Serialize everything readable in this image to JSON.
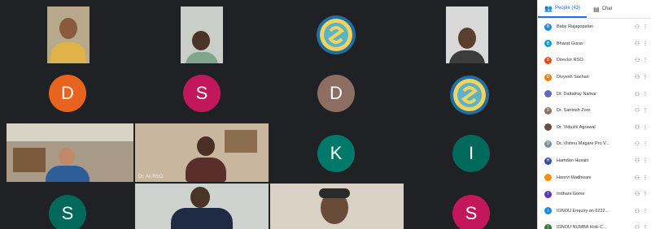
{
  "grid": {
    "avatars": [
      {
        "letter": "D",
        "color": "#e8641e"
      },
      {
        "letter": "S",
        "color": "#c2185b"
      },
      {
        "letter": "D",
        "color": "#8d6e63"
      },
      {
        "letter": "K",
        "color": "#00796b"
      },
      {
        "letter": "I",
        "color": "#00695c"
      },
      {
        "letter": "S",
        "color": "#00695c"
      },
      {
        "letter": "S",
        "color": "#c2185b"
      }
    ],
    "speaker_tag": "Dr. Ali RSO"
  },
  "panel": {
    "people_tab": "People (43)",
    "chat_tab": "Chat",
    "participants": [
      {
        "initial": "B",
        "name": "Baby Rajagopalan",
        "color": "#1e88e5"
      },
      {
        "initial": "B",
        "name": "Bharat Gurav",
        "color": "#039be5"
      },
      {
        "initial": "D",
        "name": "Director RSO",
        "color": "#e64a19"
      },
      {
        "initial": "D",
        "name": "Divyesh Sachan",
        "color": "#f57c00"
      },
      {
        "initial": "",
        "name": "Dr. Dattatray Narkar",
        "color": "#5c6bc0"
      },
      {
        "initial": "D",
        "name": "Dr. Santosh Zore",
        "color": "#8d6e63"
      },
      {
        "initial": "",
        "name": "Dr. Vidushi Agrawal",
        "color": "#6d4c41"
      },
      {
        "initial": "D",
        "name": "Dr. Vishnu Magare Pro V...",
        "color": "#78909c"
      },
      {
        "initial": "H",
        "name": "Hamdan Husain",
        "color": "#3949ab"
      },
      {
        "initial": "",
        "name": "Hoorvi Madhwani",
        "color": "#ff8f00"
      },
      {
        "initial": "I",
        "name": "Indhani Gome",
        "color": "#5e35b1"
      },
      {
        "initial": "I",
        "name": "IGNOU Enquiry on 6222...",
        "color": "#1e88e5"
      },
      {
        "initial": "I",
        "name": "IGNOU NUMBA Hoki C...",
        "color": "#2e7d32"
      }
    ]
  }
}
